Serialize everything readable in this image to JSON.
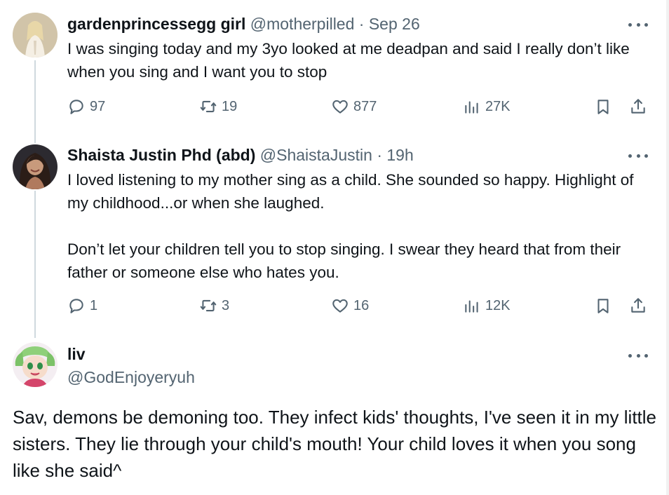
{
  "tweets": [
    {
      "name": "gardenprincessegg girl",
      "handle": "@motherpilled",
      "dot": "·",
      "time": "Sep 26",
      "paragraphs": [
        "I was singing today and my 3yo looked at me deadpan and said I really don’t like when you sing and I want you to stop"
      ],
      "stats": {
        "replies": "97",
        "reposts": "19",
        "likes": "877",
        "views": "27K"
      }
    },
    {
      "name": "Shaista Justin Phd (abd)",
      "handle": "@ShaistaJustin",
      "dot": "·",
      "time": "19h",
      "paragraphs": [
        "I loved listening to my mother sing as a child. She sounded so happy. Highlight of my childhood...or when she laughed.",
        "Don’t let your children tell you to stop singing. I swear they heard that from their father or someone else who hates you."
      ],
      "stats": {
        "replies": "1",
        "reposts": "3",
        "likes": "16",
        "views": "12K"
      }
    },
    {
      "name": "liv",
      "handle": "@GodEnjoyeryuh",
      "text": "Sav, demons be demoning too. They infect kids' thoughts, I've seen it in my little sisters. They lie through your child's mouth! Your child loves it when you song like she said^"
    }
  ],
  "icons": {
    "reply": "reply-icon",
    "repost": "repost-icon",
    "like": "heart-icon",
    "views": "views-chart-icon",
    "bookmark": "bookmark-icon",
    "share": "share-icon",
    "more": "more-icon"
  },
  "colors": {
    "text": "#0f1419",
    "secondary": "#536471",
    "thread_line": "#cfd9de"
  }
}
